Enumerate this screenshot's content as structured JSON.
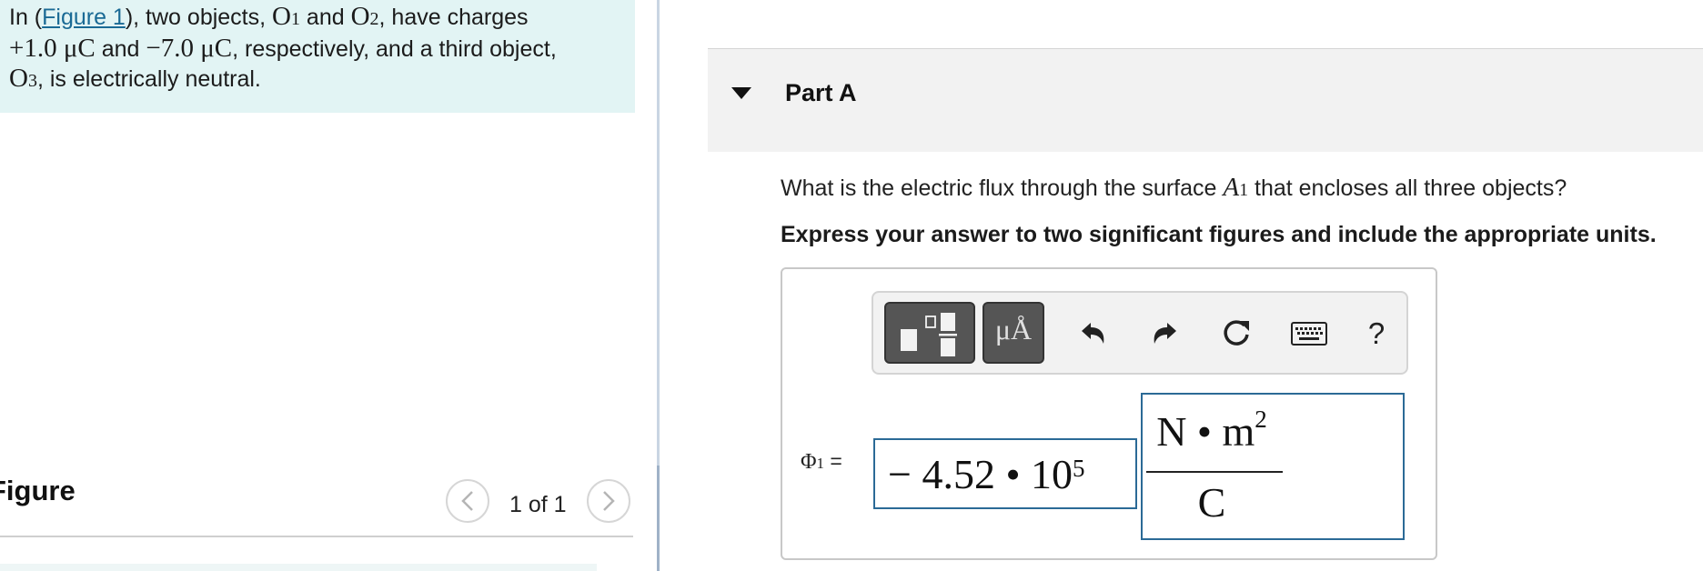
{
  "intro": {
    "text_in": "In (",
    "figure_link": "Figure 1",
    "text_after_link": "), two objects, ",
    "obj1": "O",
    "obj1_sub": "1",
    "text_and": " and ",
    "obj2": "O",
    "obj2_sub": "2",
    "text_have": ", have charges",
    "charge1": "+1.0 μC",
    "text_and2": " and ",
    "charge2": "−7.0 μC",
    "text_resp": ", respectively, and a third object,",
    "obj3": "O",
    "obj3_sub": "3",
    "text_neutral": ", is electrically neutral."
  },
  "figure_panel": {
    "title": "Figure",
    "pager_text": "1 of 1",
    "prev_icon": "chevron-left-icon",
    "next_icon": "chevron-right-icon"
  },
  "part": {
    "title": "Part A",
    "toggle_icon": "caret-down-icon"
  },
  "question": {
    "before": "What is the electric flux through the surface ",
    "var": "A",
    "var_sub": "1",
    "after": " that encloses all three objects?"
  },
  "instructions": "Express your answer to two significant figures and include the appropriate units.",
  "toolbar": {
    "units_label": "μÅ",
    "help_label": "?",
    "icons": [
      "templates-icon",
      "units-icon",
      "undo-icon",
      "redo-icon",
      "reset-icon",
      "keyboard-icon",
      "help-icon"
    ]
  },
  "answer": {
    "label_symbol": "Φ",
    "label_sub": "1",
    "label_eq": " =",
    "value_mantissa": "− 4.52 • 10",
    "value_exponent": "5",
    "unit_numerator": "N • m",
    "unit_numerator_exp": "2",
    "unit_denominator": "C"
  }
}
